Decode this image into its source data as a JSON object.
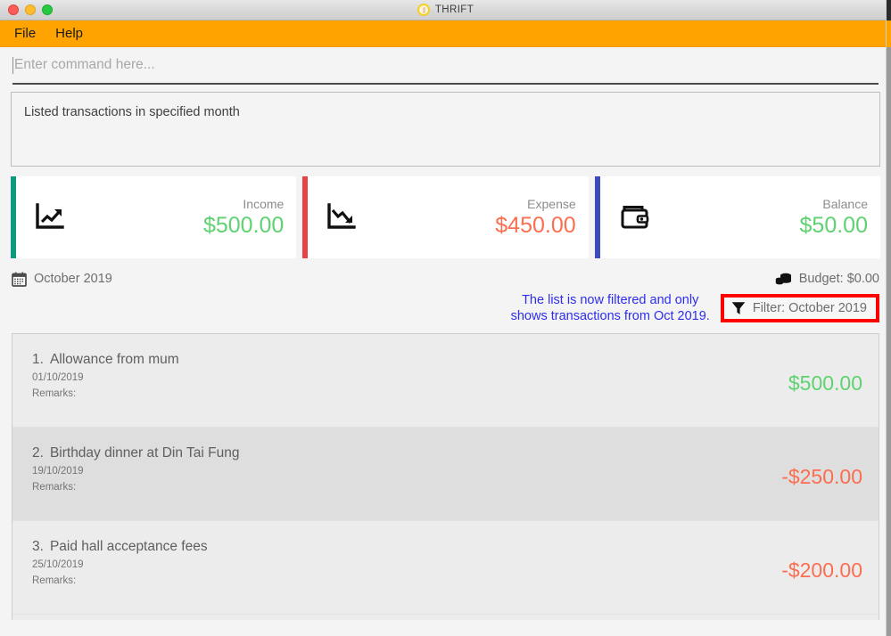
{
  "window": {
    "title": "THRIFT",
    "logo_icon": "thrift-logo-icon",
    "controls": {
      "close": "close-button",
      "minimize": "minimize-button",
      "maximize": "maximize-button"
    }
  },
  "menubar": {
    "items": [
      {
        "label": "File"
      },
      {
        "label": "Help"
      }
    ],
    "background": "#ffa300"
  },
  "command": {
    "value": "",
    "placeholder": "Enter command here..."
  },
  "result": {
    "text": "Listed transactions in specified month"
  },
  "summary": {
    "cards": [
      {
        "label": "Income",
        "value": "$500.00",
        "icon": "chart-line-up-icon",
        "accent": "#0d9a7f",
        "value_color": "#5fd271"
      },
      {
        "label": "Expense",
        "value": "$450.00",
        "icon": "chart-line-down-icon",
        "accent": "#e84242",
        "value_color": "#fb6e50"
      },
      {
        "label": "Balance",
        "value": "$50.00",
        "icon": "wallet-icon",
        "accent": "#3b4bbf",
        "value_color": "#5fd271"
      }
    ]
  },
  "month_row": {
    "calendar_icon": "calendar-icon",
    "month": "October 2019",
    "budget_icon": "coins-icon",
    "budget": "Budget: $0.00"
  },
  "annotation": {
    "line1": "The list is now filtered and only",
    "line2": "shows transactions from Oct 2019.",
    "color": "#2d2df0"
  },
  "filter": {
    "icon": "funnel-icon",
    "label": "Filter: October 2019",
    "highlight_color": "#ff0000"
  },
  "transactions": [
    {
      "index": "1.",
      "title": "Allowance from mum",
      "date": "01/10/2019",
      "remarks": "Remarks:",
      "amount": "$500.00",
      "amount_color": "#5fd271"
    },
    {
      "index": "2.",
      "title": "Birthday dinner at Din Tai Fung",
      "date": "19/10/2019",
      "remarks": "Remarks:",
      "amount": "-$250.00",
      "amount_color": "#fb6e50"
    },
    {
      "index": "3.",
      "title": "Paid hall acceptance fees",
      "date": "25/10/2019",
      "remarks": "Remarks:",
      "amount": "-$200.00",
      "amount_color": "#fb6e50"
    }
  ]
}
